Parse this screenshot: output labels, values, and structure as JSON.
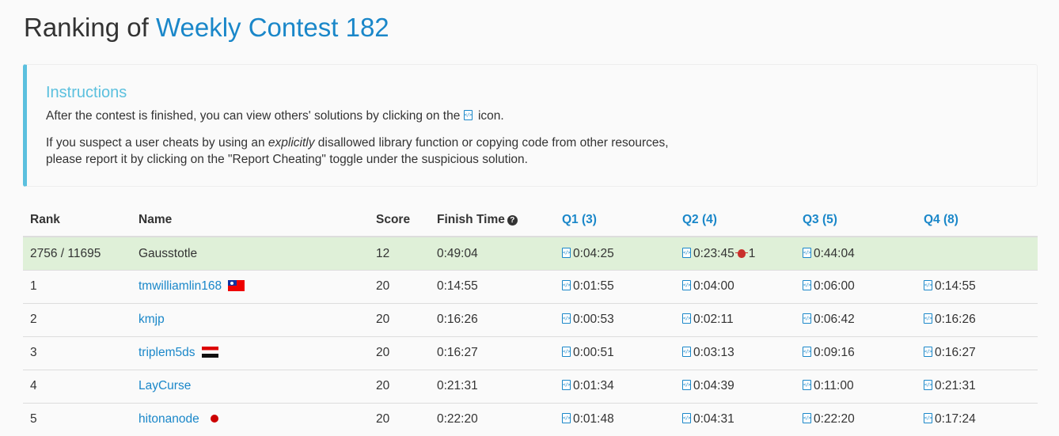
{
  "page": {
    "title_prefix": "Ranking of ",
    "contest_name": "Weekly Contest 182"
  },
  "instructions": {
    "heading": "Instructions",
    "line1_before": "After the contest is finished, you can view others' solutions by clicking on the ",
    "line1_after": " icon.",
    "line2_before": "If you suspect a user cheats by using an ",
    "line2_em": "explicitly",
    "line2_after": " disallowed library function or copying code from other resources,",
    "line3": "please report it by clicking on the \"Report Cheating\" toggle under the suspicious solution."
  },
  "table": {
    "headers": {
      "rank": "Rank",
      "name": "Name",
      "score": "Score",
      "finish_time": "Finish Time",
      "q1": "Q1 (3)",
      "q2": "Q2 (4)",
      "q3": "Q3 (5)",
      "q4": "Q4 (8)"
    },
    "my_row": {
      "rank": "2756 / 11695",
      "name": "Gausstotle",
      "score": "12",
      "finish_time": "0:49:04",
      "q1": "0:04:25",
      "q2": "0:23:45",
      "q2_bug_count": "1",
      "q3": "0:44:04",
      "q4": ""
    },
    "rows": [
      {
        "rank": "1",
        "name": "tmwilliamlin168",
        "flag": "tw-flag-icon",
        "score": "20",
        "finish_time": "0:14:55",
        "q1": "0:01:55",
        "q2": "0:04:00",
        "q3": "0:06:00",
        "q4": "0:14:55"
      },
      {
        "rank": "2",
        "name": "kmjp",
        "flag": "",
        "score": "20",
        "finish_time": "0:16:26",
        "q1": "0:00:53",
        "q2": "0:02:11",
        "q3": "0:06:42",
        "q4": "0:16:26"
      },
      {
        "rank": "3",
        "name": "triplem5ds",
        "flag": "eg-flag-icon",
        "score": "20",
        "finish_time": "0:16:27",
        "q1": "0:00:51",
        "q2": "0:03:13",
        "q3": "0:09:16",
        "q4": "0:16:27"
      },
      {
        "rank": "4",
        "name": "LayCurse",
        "flag": "",
        "score": "20",
        "finish_time": "0:21:31",
        "q1": "0:01:34",
        "q2": "0:04:39",
        "q3": "0:11:00",
        "q4": "0:21:31"
      },
      {
        "rank": "5",
        "name": "hitonanode",
        "flag": "jp-flag-icon",
        "score": "20",
        "finish_time": "0:22:20",
        "q1": "0:01:48",
        "q2": "0:04:31",
        "q3": "0:22:20",
        "q4": "0:17:24"
      }
    ]
  },
  "colors": {
    "link": "#1a87c9",
    "callout_border": "#5bc0de",
    "my_row_bg": "#dff0d8",
    "bug": "#c9302c"
  }
}
